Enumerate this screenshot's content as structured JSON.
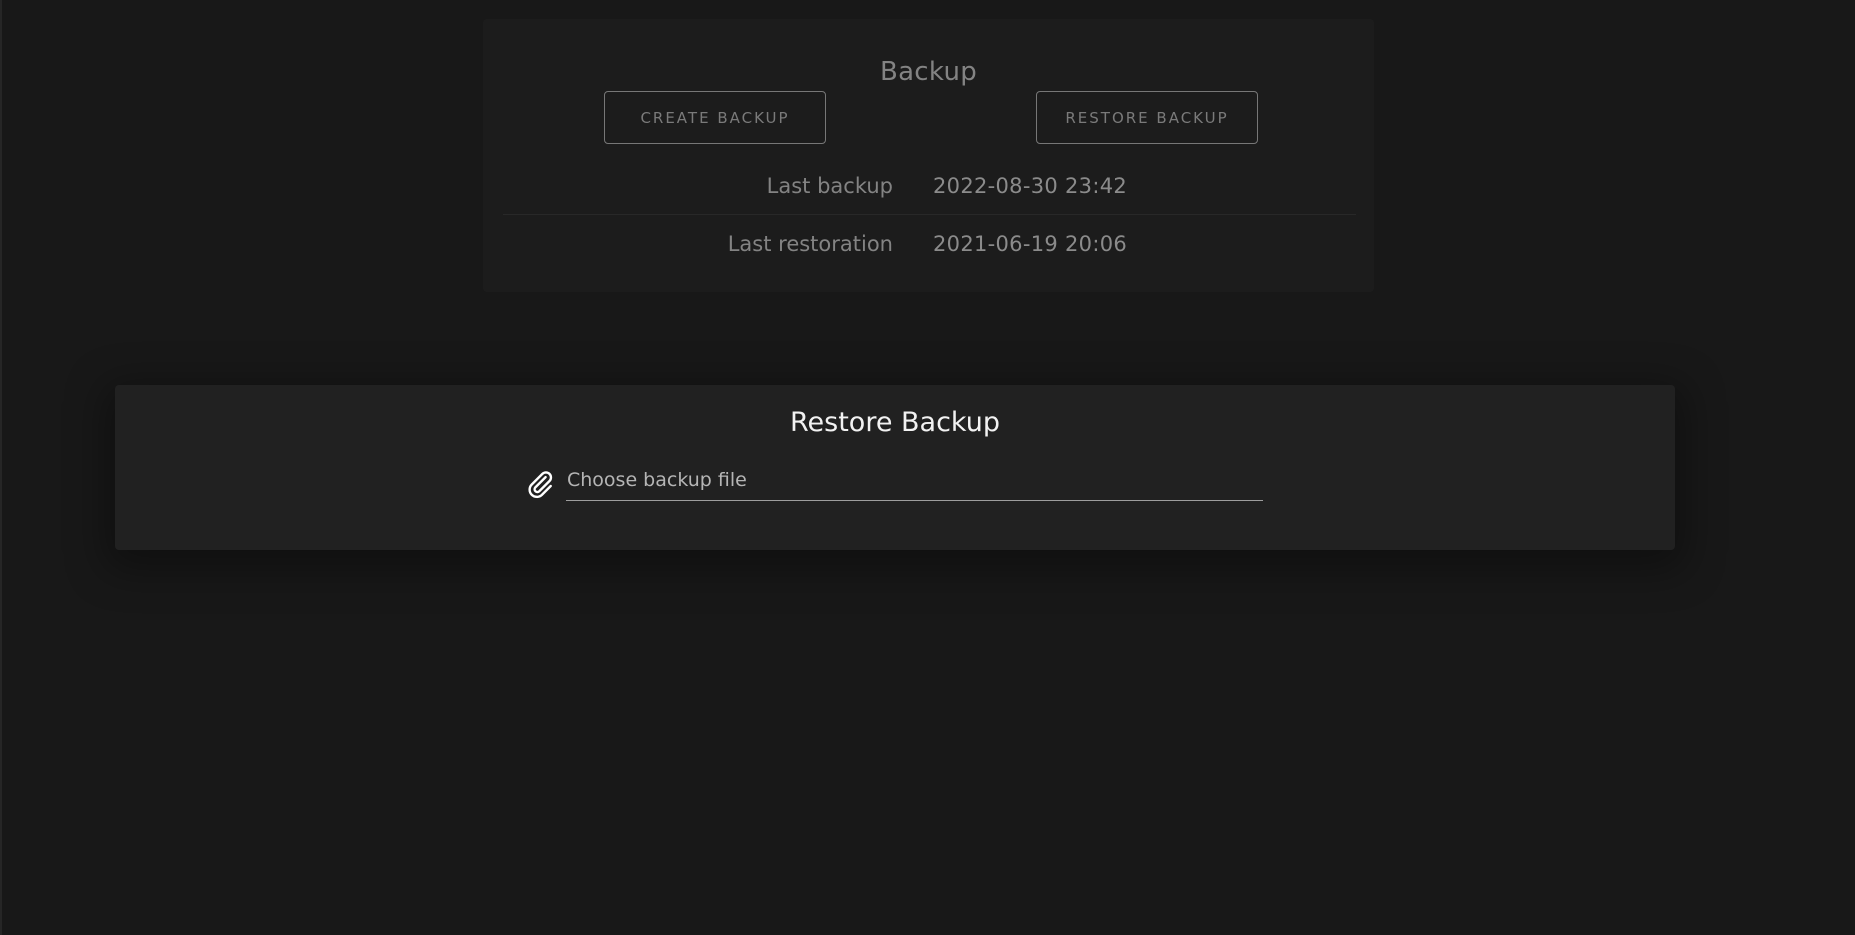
{
  "backup": {
    "title": "Backup",
    "create_button": "CREATE BACKUP",
    "restore_button": "RESTORE BACKUP",
    "rows": [
      {
        "label": "Last backup",
        "value": "2022-08-30 23:42"
      },
      {
        "label": "Last restoration",
        "value": "2021-06-19 20:06"
      }
    ]
  },
  "restore_dialog": {
    "title": "Restore Backup",
    "file_placeholder": "Choose backup file",
    "icon": "paperclip-icon"
  },
  "colors": {
    "background": "#181818",
    "card": "#212121",
    "title_text": "#f2f2f2",
    "muted_text": "#9a9a9a"
  }
}
